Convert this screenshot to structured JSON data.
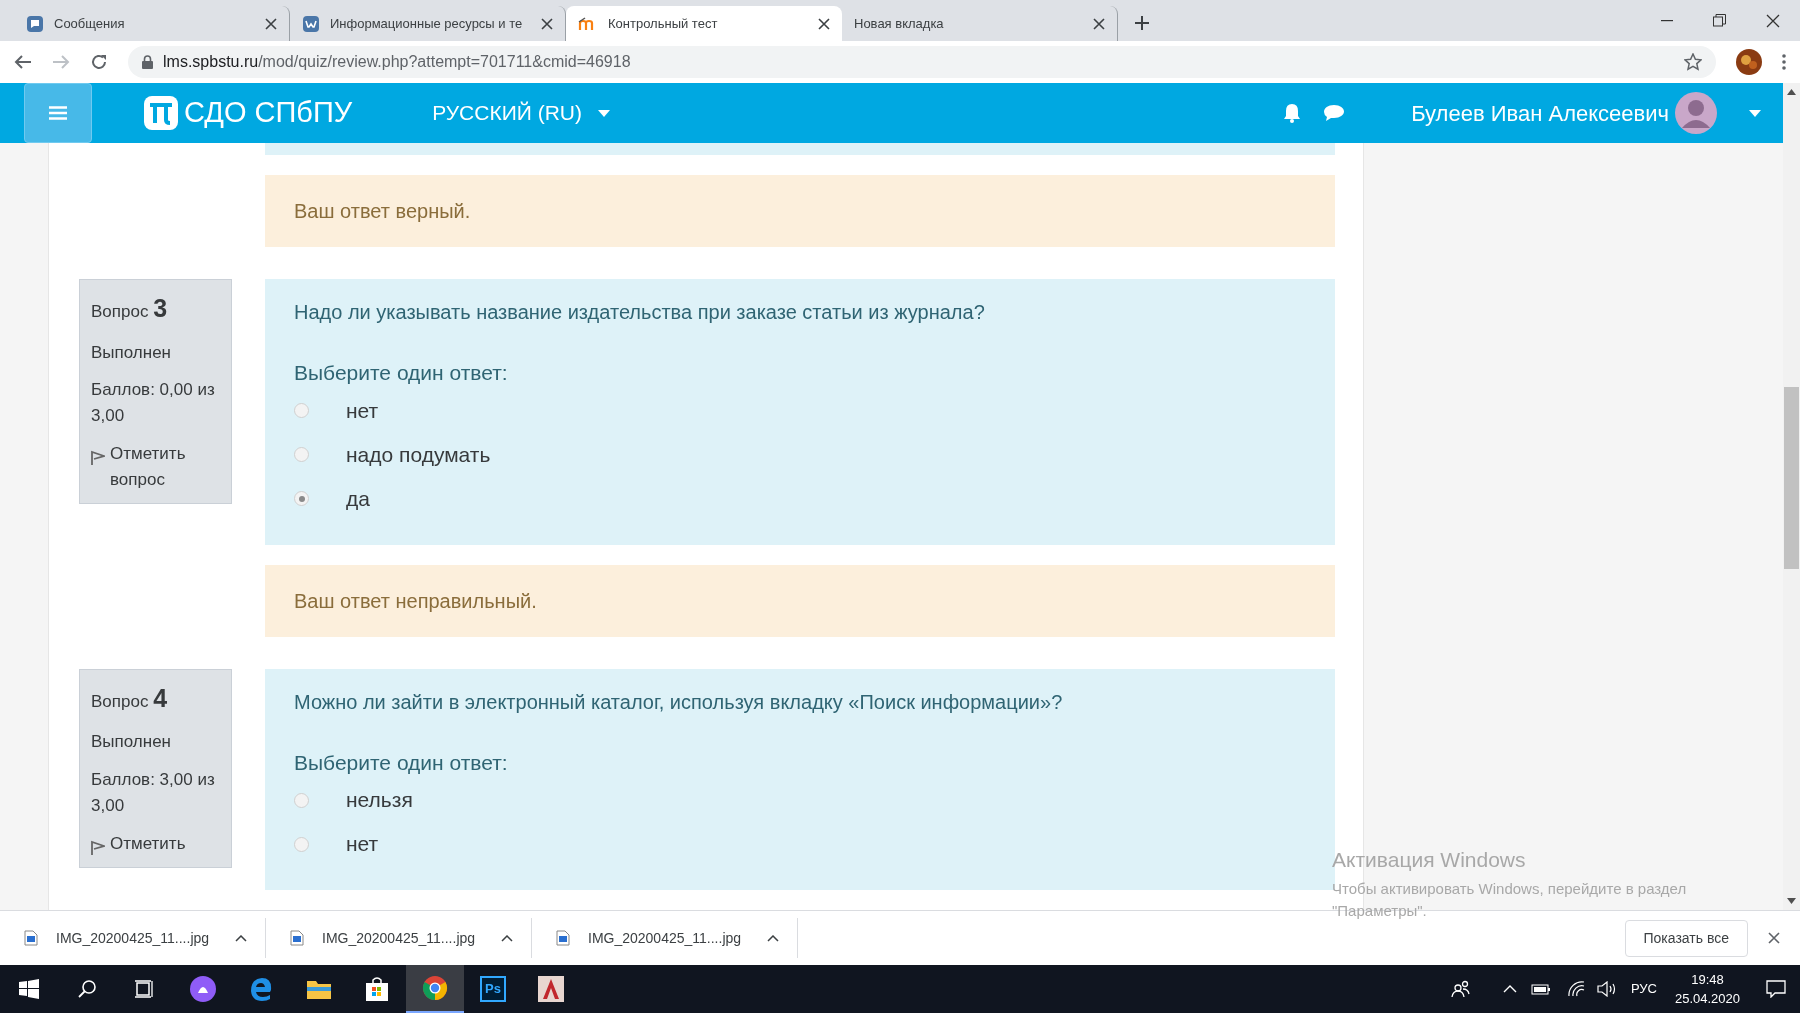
{
  "browser": {
    "tabs": [
      {
        "title": "Сообщения",
        "kind": "chat",
        "selected": false
      },
      {
        "title": "Информационные ресурсы и те",
        "kind": "vk",
        "selected": false
      },
      {
        "title": "Контрольный тест",
        "kind": "moodle",
        "selected": true
      },
      {
        "title": "Новая вкладка",
        "kind": "blank",
        "selected": false
      }
    ],
    "url_host": "lms.spbstu.ru",
    "url_path": "/mod/quiz/review.php?attempt=701711&cmid=46918"
  },
  "header": {
    "site_name": "СДО СПбПУ",
    "language": "РУССКИЙ (RU)",
    "user_name": "Булеев Иван Алексеевич"
  },
  "previous_feedback": "Ваш ответ верный.",
  "questions": [
    {
      "label": "Вопрос",
      "number": "3",
      "status": "Выполнен",
      "score": "Баллов: 0,00 из 3,00",
      "flag_label": "Отметить вопрос",
      "text": "Надо ли указывать название издательства при заказе статьи из журнала?",
      "prompt": "Выберите один ответ:",
      "options": [
        {
          "label": "нет",
          "selected": false
        },
        {
          "label": "надо подумать",
          "selected": false
        },
        {
          "label": "да",
          "selected": true
        }
      ],
      "feedback": "Ваш ответ неправильный."
    },
    {
      "label": "Вопрос",
      "number": "4",
      "status": "Выполнен",
      "score": "Баллов: 3,00 из 3,00",
      "flag_label": "Отметить",
      "text": "Можно ли зайти в электронный каталог, используя вкладку «Поиск информации»?",
      "prompt": "Выберите один ответ:",
      "options": [
        {
          "label": "нельзя",
          "selected": false
        },
        {
          "label": "нет",
          "selected": false
        }
      ]
    }
  ],
  "activation": {
    "title": "Активация Windows",
    "text": "Чтобы активировать Windows, перейдите в раздел \"Параметры\"."
  },
  "downloads": {
    "files": [
      {
        "name": "IMG_20200425_11....jpg"
      },
      {
        "name": "IMG_20200425_11....jpg"
      },
      {
        "name": "IMG_20200425_11....jpg"
      }
    ],
    "show_all": "Показать все"
  },
  "taskbar": {
    "apps": [
      {
        "kind": "start",
        "selected": false
      },
      {
        "kind": "search",
        "selected": false
      },
      {
        "kind": "taskview",
        "selected": false
      },
      {
        "kind": "alice",
        "selected": false
      },
      {
        "kind": "edge",
        "selected": false
      },
      {
        "kind": "explorer",
        "selected": false
      },
      {
        "kind": "store",
        "selected": false
      },
      {
        "kind": "chrome",
        "selected": true
      },
      {
        "kind": "photoshop",
        "label": "Ps",
        "selected": false
      },
      {
        "kind": "autocad",
        "selected": false
      }
    ],
    "language": "РУС",
    "time": "19:48",
    "date": "25.04.2020"
  }
}
